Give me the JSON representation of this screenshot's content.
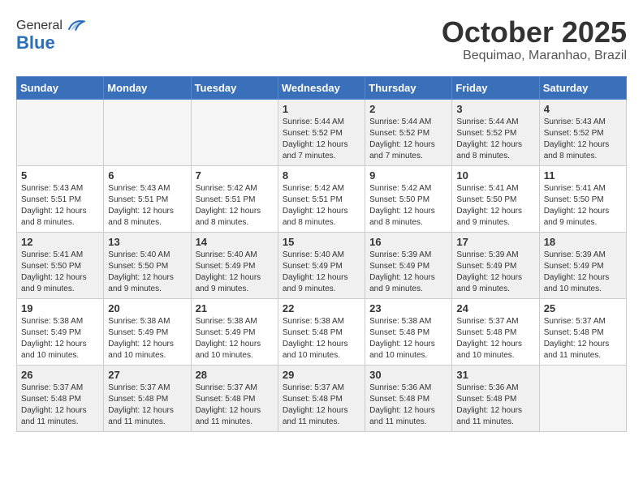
{
  "header": {
    "logo_general": "General",
    "logo_blue": "Blue",
    "month_title": "October 2025",
    "location": "Bequimao, Maranhao, Brazil"
  },
  "weekdays": [
    "Sunday",
    "Monday",
    "Tuesday",
    "Wednesday",
    "Thursday",
    "Friday",
    "Saturday"
  ],
  "weeks": [
    [
      {
        "day": "",
        "empty": true
      },
      {
        "day": "",
        "empty": true
      },
      {
        "day": "",
        "empty": true
      },
      {
        "day": "1",
        "sunrise": "5:44 AM",
        "sunset": "5:52 PM",
        "daylight": "12 hours and 7 minutes."
      },
      {
        "day": "2",
        "sunrise": "5:44 AM",
        "sunset": "5:52 PM",
        "daylight": "12 hours and 7 minutes."
      },
      {
        "day": "3",
        "sunrise": "5:44 AM",
        "sunset": "5:52 PM",
        "daylight": "12 hours and 8 minutes."
      },
      {
        "day": "4",
        "sunrise": "5:43 AM",
        "sunset": "5:52 PM",
        "daylight": "12 hours and 8 minutes."
      }
    ],
    [
      {
        "day": "5",
        "sunrise": "5:43 AM",
        "sunset": "5:51 PM",
        "daylight": "12 hours and 8 minutes."
      },
      {
        "day": "6",
        "sunrise": "5:43 AM",
        "sunset": "5:51 PM",
        "daylight": "12 hours and 8 minutes."
      },
      {
        "day": "7",
        "sunrise": "5:42 AM",
        "sunset": "5:51 PM",
        "daylight": "12 hours and 8 minutes."
      },
      {
        "day": "8",
        "sunrise": "5:42 AM",
        "sunset": "5:51 PM",
        "daylight": "12 hours and 8 minutes."
      },
      {
        "day": "9",
        "sunrise": "5:42 AM",
        "sunset": "5:50 PM",
        "daylight": "12 hours and 8 minutes."
      },
      {
        "day": "10",
        "sunrise": "5:41 AM",
        "sunset": "5:50 PM",
        "daylight": "12 hours and 9 minutes."
      },
      {
        "day": "11",
        "sunrise": "5:41 AM",
        "sunset": "5:50 PM",
        "daylight": "12 hours and 9 minutes."
      }
    ],
    [
      {
        "day": "12",
        "sunrise": "5:41 AM",
        "sunset": "5:50 PM",
        "daylight": "12 hours and 9 minutes."
      },
      {
        "day": "13",
        "sunrise": "5:40 AM",
        "sunset": "5:50 PM",
        "daylight": "12 hours and 9 minutes."
      },
      {
        "day": "14",
        "sunrise": "5:40 AM",
        "sunset": "5:49 PM",
        "daylight": "12 hours and 9 minutes."
      },
      {
        "day": "15",
        "sunrise": "5:40 AM",
        "sunset": "5:49 PM",
        "daylight": "12 hours and 9 minutes."
      },
      {
        "day": "16",
        "sunrise": "5:39 AM",
        "sunset": "5:49 PM",
        "daylight": "12 hours and 9 minutes."
      },
      {
        "day": "17",
        "sunrise": "5:39 AM",
        "sunset": "5:49 PM",
        "daylight": "12 hours and 9 minutes."
      },
      {
        "day": "18",
        "sunrise": "5:39 AM",
        "sunset": "5:49 PM",
        "daylight": "12 hours and 10 minutes."
      }
    ],
    [
      {
        "day": "19",
        "sunrise": "5:38 AM",
        "sunset": "5:49 PM",
        "daylight": "12 hours and 10 minutes."
      },
      {
        "day": "20",
        "sunrise": "5:38 AM",
        "sunset": "5:49 PM",
        "daylight": "12 hours and 10 minutes."
      },
      {
        "day": "21",
        "sunrise": "5:38 AM",
        "sunset": "5:49 PM",
        "daylight": "12 hours and 10 minutes."
      },
      {
        "day": "22",
        "sunrise": "5:38 AM",
        "sunset": "5:48 PM",
        "daylight": "12 hours and 10 minutes."
      },
      {
        "day": "23",
        "sunrise": "5:38 AM",
        "sunset": "5:48 PM",
        "daylight": "12 hours and 10 minutes."
      },
      {
        "day": "24",
        "sunrise": "5:37 AM",
        "sunset": "5:48 PM",
        "daylight": "12 hours and 10 minutes."
      },
      {
        "day": "25",
        "sunrise": "5:37 AM",
        "sunset": "5:48 PM",
        "daylight": "12 hours and 11 minutes."
      }
    ],
    [
      {
        "day": "26",
        "sunrise": "5:37 AM",
        "sunset": "5:48 PM",
        "daylight": "12 hours and 11 minutes."
      },
      {
        "day": "27",
        "sunrise": "5:37 AM",
        "sunset": "5:48 PM",
        "daylight": "12 hours and 11 minutes."
      },
      {
        "day": "28",
        "sunrise": "5:37 AM",
        "sunset": "5:48 PM",
        "daylight": "12 hours and 11 minutes."
      },
      {
        "day": "29",
        "sunrise": "5:37 AM",
        "sunset": "5:48 PM",
        "daylight": "12 hours and 11 minutes."
      },
      {
        "day": "30",
        "sunrise": "5:36 AM",
        "sunset": "5:48 PM",
        "daylight": "12 hours and 11 minutes."
      },
      {
        "day": "31",
        "sunrise": "5:36 AM",
        "sunset": "5:48 PM",
        "daylight": "12 hours and 11 minutes."
      },
      {
        "day": "",
        "empty": true
      }
    ]
  ],
  "labels": {
    "sunrise": "Sunrise:",
    "sunset": "Sunset:",
    "daylight": "Daylight:"
  }
}
